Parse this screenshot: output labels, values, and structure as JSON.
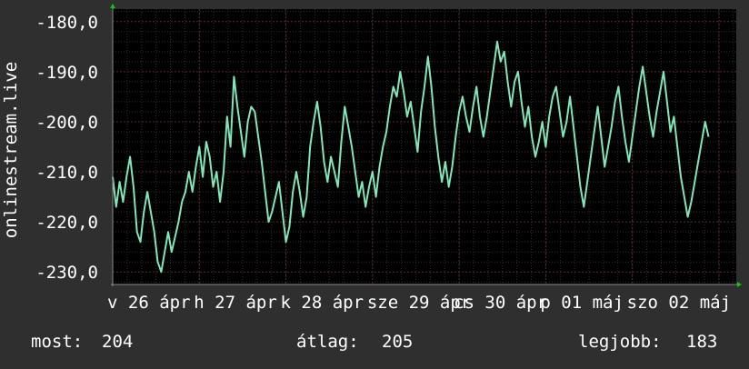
{
  "colors": {
    "background": "#2f2f2f",
    "plot_background": "#000000",
    "grid_major": "#5a2a2a",
    "grid_minor": "#2e2e2e",
    "line": "#7fe7b8",
    "axis_arrow": "#00d000",
    "text": "#ffffff"
  },
  "chart_data": {
    "type": "line",
    "ylabel": "onlinestream.live",
    "ylim": [
      -232.5,
      -177.5
    ],
    "y_ticks": [
      -180,
      -190,
      -200,
      -210,
      -220,
      -230
    ],
    "y_tick_labels": [
      "-180,0",
      "-190,0",
      "-200,0",
      "-210,0",
      "-220,0",
      "-230,0"
    ],
    "x_ticks": [
      0,
      1,
      2,
      3,
      4,
      5,
      6,
      7
    ],
    "x_tick_labels": [
      "v 26 ápr",
      "h 27 ápr",
      "k 28 ápr",
      "sze 29 ápr",
      "cs 30 ápr",
      "p 01 máj",
      "szo 02 máj",
      ""
    ],
    "xlim": [
      0,
      7.2
    ],
    "grid": true,
    "series": [
      {
        "values": [
          [
            0.0,
            -211
          ],
          [
            0.04,
            -217
          ],
          [
            0.08,
            -212
          ],
          [
            0.12,
            -216
          ],
          [
            0.16,
            -211
          ],
          [
            0.2,
            -207
          ],
          [
            0.24,
            -213
          ],
          [
            0.28,
            -222
          ],
          [
            0.32,
            -224
          ],
          [
            0.36,
            -218
          ],
          [
            0.4,
            -214
          ],
          [
            0.44,
            -218
          ],
          [
            0.48,
            -222
          ],
          [
            0.52,
            -228
          ],
          [
            0.56,
            -230
          ],
          [
            0.6,
            -226
          ],
          [
            0.64,
            -222
          ],
          [
            0.68,
            -226
          ],
          [
            0.72,
            -223
          ],
          [
            0.76,
            -220
          ],
          [
            0.8,
            -216
          ],
          [
            0.84,
            -214
          ],
          [
            0.88,
            -210
          ],
          [
            0.92,
            -214
          ],
          [
            0.96,
            -209
          ],
          [
            1.0,
            -205
          ],
          [
            1.04,
            -211
          ],
          [
            1.08,
            -204
          ],
          [
            1.12,
            -207
          ],
          [
            1.16,
            -213
          ],
          [
            1.2,
            -210
          ],
          [
            1.24,
            -216
          ],
          [
            1.28,
            -210
          ],
          [
            1.32,
            -199
          ],
          [
            1.36,
            -205
          ],
          [
            1.4,
            -191
          ],
          [
            1.44,
            -197
          ],
          [
            1.48,
            -202
          ],
          [
            1.52,
            -207
          ],
          [
            1.56,
            -200
          ],
          [
            1.6,
            -197
          ],
          [
            1.64,
            -198
          ],
          [
            1.68,
            -203
          ],
          [
            1.72,
            -208
          ],
          [
            1.76,
            -214
          ],
          [
            1.8,
            -220
          ],
          [
            1.84,
            -218
          ],
          [
            1.88,
            -215
          ],
          [
            1.92,
            -212
          ],
          [
            1.96,
            -218
          ],
          [
            2.0,
            -224
          ],
          [
            2.04,
            -221
          ],
          [
            2.08,
            -214
          ],
          [
            2.12,
            -210
          ],
          [
            2.16,
            -214
          ],
          [
            2.2,
            -219
          ],
          [
            2.24,
            -215
          ],
          [
            2.28,
            -205
          ],
          [
            2.32,
            -200
          ],
          [
            2.36,
            -196
          ],
          [
            2.4,
            -201
          ],
          [
            2.44,
            -208
          ],
          [
            2.48,
            -212
          ],
          [
            2.52,
            -207
          ],
          [
            2.56,
            -210
          ],
          [
            2.6,
            -213
          ],
          [
            2.64,
            -204
          ],
          [
            2.68,
            -197
          ],
          [
            2.72,
            -201
          ],
          [
            2.76,
            -205
          ],
          [
            2.8,
            -210
          ],
          [
            2.84,
            -215
          ],
          [
            2.88,
            -212
          ],
          [
            2.92,
            -217
          ],
          [
            2.96,
            -213
          ],
          [
            3.0,
            -210
          ],
          [
            3.04,
            -215
          ],
          [
            3.08,
            -209
          ],
          [
            3.12,
            -205
          ],
          [
            3.16,
            -202
          ],
          [
            3.2,
            -197
          ],
          [
            3.24,
            -193
          ],
          [
            3.28,
            -195
          ],
          [
            3.32,
            -190
          ],
          [
            3.36,
            -194
          ],
          [
            3.4,
            -199
          ],
          [
            3.44,
            -196
          ],
          [
            3.48,
            -201
          ],
          [
            3.52,
            -206
          ],
          [
            3.56,
            -198
          ],
          [
            3.6,
            -193
          ],
          [
            3.64,
            -187
          ],
          [
            3.68,
            -193
          ],
          [
            3.72,
            -201
          ],
          [
            3.76,
            -207
          ],
          [
            3.8,
            -212
          ],
          [
            3.84,
            -208
          ],
          [
            3.88,
            -213
          ],
          [
            3.92,
            -209
          ],
          [
            3.96,
            -203
          ],
          [
            4.0,
            -198
          ],
          [
            4.04,
            -195
          ],
          [
            4.08,
            -199
          ],
          [
            4.12,
            -202
          ],
          [
            4.16,
            -197
          ],
          [
            4.2,
            -193
          ],
          [
            4.24,
            -199
          ],
          [
            4.28,
            -203
          ],
          [
            4.32,
            -199
          ],
          [
            4.36,
            -194
          ],
          [
            4.4,
            -189
          ],
          [
            4.44,
            -184
          ],
          [
            4.48,
            -188
          ],
          [
            4.52,
            -186
          ],
          [
            4.56,
            -192
          ],
          [
            4.6,
            -197
          ],
          [
            4.64,
            -192
          ],
          [
            4.68,
            -190
          ],
          [
            4.72,
            -196
          ],
          [
            4.76,
            -201
          ],
          [
            4.8,
            -197
          ],
          [
            4.84,
            -203
          ],
          [
            4.88,
            -207
          ],
          [
            4.92,
            -204
          ],
          [
            4.96,
            -200
          ],
          [
            5.0,
            -205
          ],
          [
            5.04,
            -199
          ],
          [
            5.08,
            -195
          ],
          [
            5.12,
            -193
          ],
          [
            5.16,
            -198
          ],
          [
            5.2,
            -203
          ],
          [
            5.24,
            -200
          ],
          [
            5.28,
            -195
          ],
          [
            5.32,
            -201
          ],
          [
            5.36,
            -207
          ],
          [
            5.4,
            -213
          ],
          [
            5.44,
            -217
          ],
          [
            5.48,
            -212
          ],
          [
            5.52,
            -207
          ],
          [
            5.56,
            -202
          ],
          [
            5.6,
            -197
          ],
          [
            5.64,
            -203
          ],
          [
            5.68,
            -209
          ],
          [
            5.72,
            -205
          ],
          [
            5.76,
            -201
          ],
          [
            5.8,
            -196
          ],
          [
            5.84,
            -193
          ],
          [
            5.88,
            -199
          ],
          [
            5.92,
            -204
          ],
          [
            5.96,
            -208
          ],
          [
            6.0,
            -203
          ],
          [
            6.04,
            -198
          ],
          [
            6.08,
            -193
          ],
          [
            6.12,
            -189
          ],
          [
            6.16,
            -194
          ],
          [
            6.2,
            -199
          ],
          [
            6.24,
            -203
          ],
          [
            6.28,
            -198
          ],
          [
            6.32,
            -194
          ],
          [
            6.36,
            -190
          ],
          [
            6.4,
            -196
          ],
          [
            6.44,
            -202
          ],
          [
            6.48,
            -199
          ],
          [
            6.52,
            -205
          ],
          [
            6.56,
            -211
          ],
          [
            6.6,
            -215
          ],
          [
            6.64,
            -219
          ],
          [
            6.68,
            -216
          ],
          [
            6.72,
            -212
          ],
          [
            6.76,
            -208
          ],
          [
            6.8,
            -204
          ],
          [
            6.84,
            -200
          ],
          [
            6.88,
            -203
          ]
        ]
      }
    ]
  },
  "legend": {
    "current_label": "most:",
    "current_value": "204",
    "average_label": "átlag:",
    "average_value": "205",
    "best_label": "legjobb:",
    "best_value": "183"
  }
}
